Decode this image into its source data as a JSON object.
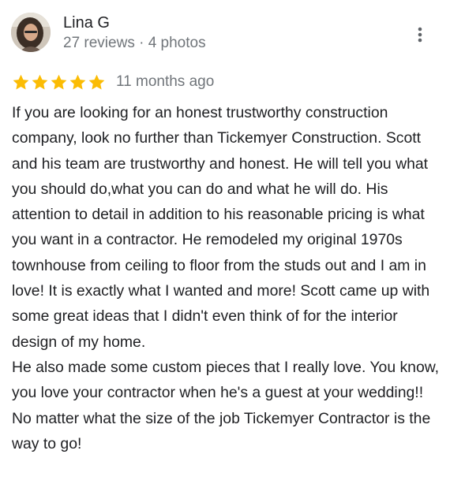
{
  "reviewer": {
    "name": "Lina G",
    "meta": "27 reviews · 4 photos",
    "avatar_icon": "user-avatar-photo"
  },
  "review": {
    "rating": 5,
    "rating_max": 5,
    "star_color": "#fbbc04",
    "time": "11 months ago",
    "text": "If you are looking for an honest trustworthy construction company, look no further than Tickemyer Construction. Scott and his team are trustworthy and honest. He will tell you what you should do,what you can do and what he will do. His attention to detail in addition to his reasonable pricing is what you want in a contractor. He remodeled my original 1970s townhouse from ceiling to floor from the studs out and I am in love! It is exactly what I wanted and more! Scott came up with some great ideas that I didn't even think of for the interior design of my home.\nHe also made some custom pieces that I really love. You know, you love your contractor when he's a guest at your wedding!! No matter what the size of the job Tickemyer Contractor is the way to go!"
  },
  "menu": {
    "icon": "more-vert-icon"
  }
}
